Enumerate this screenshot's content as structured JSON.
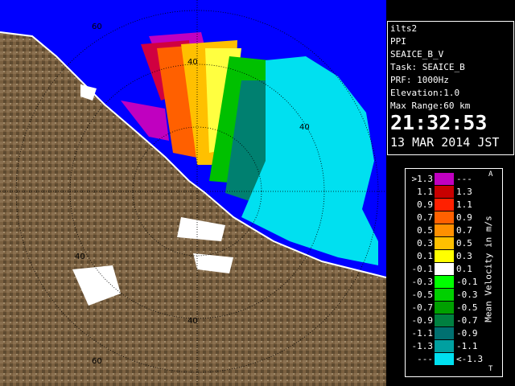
{
  "info": {
    "station": "ilts2",
    "product": "PPI",
    "scan": "SEAICE_B_V",
    "task": "Task: SEAICE_B",
    "prf": "PRF: 1000Hz",
    "elevation": "Elevation:1.0",
    "max_range": "Max Range:60 km",
    "time": "21:32:53",
    "date": "13 MAR 2014 JST"
  },
  "legend": {
    "title": "Mean Velocity in m/s",
    "top_marker": "A",
    "bottom_marker": "T",
    "rows": [
      {
        "left": ">1.3",
        "right": "---",
        "color": "#c000c0"
      },
      {
        "left": "1.1",
        "right": "1.3",
        "color": "#c80000"
      },
      {
        "left": "0.9",
        "right": "1.1",
        "color": "#ff2000"
      },
      {
        "left": "0.7",
        "right": "0.9",
        "color": "#ff6000"
      },
      {
        "left": "0.5",
        "right": "0.7",
        "color": "#ff9000"
      },
      {
        "left": "0.3",
        "right": "0.5",
        "color": "#ffc000"
      },
      {
        "left": "0.1",
        "right": "0.3",
        "color": "#ffff00"
      },
      {
        "left": "-0.1",
        "right": "0.1",
        "color": "#ffffff"
      },
      {
        "left": "-0.3",
        "right": "-0.1",
        "color": "#00ff00"
      },
      {
        "left": "-0.5",
        "right": "-0.3",
        "color": "#00d000"
      },
      {
        "left": "-0.7",
        "right": "-0.5",
        "color": "#00a000"
      },
      {
        "left": "-0.9",
        "right": "-0.7",
        "color": "#008040"
      },
      {
        "left": "-1.1",
        "right": "-0.9",
        "color": "#007070"
      },
      {
        "left": "-1.3",
        "right": "-1.1",
        "color": "#00a0a0"
      },
      {
        "left": "---",
        "right": "<-1.3",
        "color": "#00e0f0"
      }
    ]
  },
  "map": {
    "range_labels": [
      "60",
      "40",
      "40",
      "40",
      "40",
      "60"
    ],
    "colors": {
      "sea": "#0000ff",
      "land": "#7a6040",
      "land_dark": "#5a4428",
      "snow": "#ffffff"
    }
  }
}
